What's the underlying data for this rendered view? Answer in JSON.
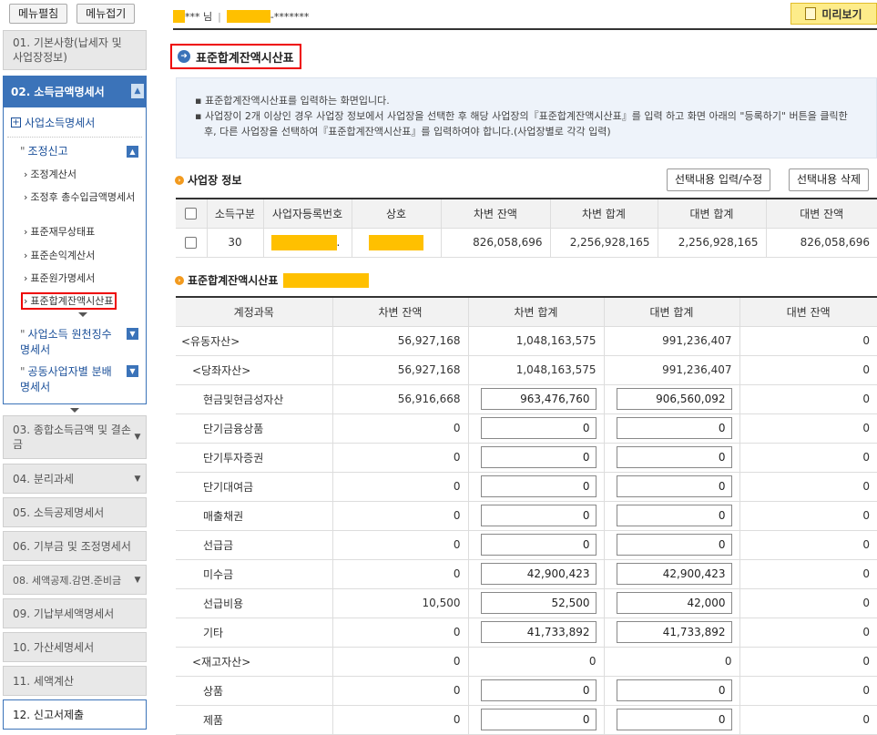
{
  "sidebar": {
    "expand_label": "메뉴펼침",
    "collapse_label": "메뉴접기",
    "menu01": "01. 기본사항(납세자 및 사업장정보)",
    "menu02": "02. 소득금액명세서",
    "sub_business": "사업소득명세서",
    "sub_adjust": "조정신고",
    "adjust_items": [
      "조정계산서",
      "조정후 총수입금액명세서",
      "표준재무상태표",
      "표준손익계산서",
      "표준원가명세서",
      "표준합계잔액시산표"
    ],
    "sub_withhold": "사업소득 원천징수명세서",
    "sub_joint": "공동사업자별 분배명세서",
    "menu03": "03. 종합소득금액 및 결손금",
    "menu04": "04. 분리과세",
    "menu05": "05. 소득공제명세서",
    "menu06": "06. 기부금 및 조정명세서",
    "menu08": "08. 세액공제.감면.준비금",
    "menu09": "09. 기납부세액명세서",
    "menu10": "10. 가산세명세서",
    "menu11": "11. 세액계산",
    "menu12": "12. 신고서제출"
  },
  "header": {
    "user_name_mask": "*** 님",
    "separator": "|",
    "user_id_mask": "-*******",
    "preview_label": "미리보기"
  },
  "page": {
    "title": "표준합계잔액시산표",
    "info_lines": [
      "표준합계잔액시산표를 입력하는 화면입니다.",
      "사업장이 2개 이상인 경우 사업장 정보에서 사업장을 선택한 후 해당 사업장의『표준합계잔액시산표』를 입력 하고 화면 아래의 \"등록하기\" 버튼을 클릭한 후, 다른 사업장을 선택하여『표준합계잔액시산표』를 입력하여야 합니다.(사업장별로 각각 입력)"
    ]
  },
  "business": {
    "section_title": "사업장 정보",
    "btn_edit": "선택내용 입력/수정",
    "btn_delete": "선택내용 삭제",
    "headers": [
      "소득구분",
      "사업자등록번호",
      "상호",
      "차변 잔액",
      "차변 합계",
      "대변 합계",
      "대변 잔액"
    ],
    "row": {
      "type": "30",
      "reg_suffix": ".",
      "debit_balance": "826,058,696",
      "debit_total": "2,256,928,165",
      "credit_total": "2,256,928,165",
      "credit_balance": "826,058,696"
    }
  },
  "trial": {
    "section_title": "표준합계잔액시산표",
    "headers": [
      "계정과목",
      "차변 잔액",
      "차변 합계",
      "대변 합계",
      "대변 잔액"
    ],
    "rows": [
      {
        "name": "<유동자산>",
        "indent": 0,
        "db": "56,927,168",
        "dt": "1,048,163,575",
        "ct": "991,236,407",
        "cb": "0",
        "input": false
      },
      {
        "name": "<당좌자산>",
        "indent": 1,
        "db": "56,927,168",
        "dt": "1,048,163,575",
        "ct": "991,236,407",
        "cb": "0",
        "input": false
      },
      {
        "name": "현금및현금성자산",
        "indent": 2,
        "db": "56,916,668",
        "dt": "963,476,760",
        "ct": "906,560,092",
        "cb": "0",
        "input": true
      },
      {
        "name": "단기금융상품",
        "indent": 2,
        "db": "0",
        "dt": "0",
        "ct": "0",
        "cb": "0",
        "input": true
      },
      {
        "name": "단기투자증권",
        "indent": 2,
        "db": "0",
        "dt": "0",
        "ct": "0",
        "cb": "0",
        "input": true
      },
      {
        "name": "단기대여금",
        "indent": 2,
        "db": "0",
        "dt": "0",
        "ct": "0",
        "cb": "0",
        "input": true
      },
      {
        "name": "매출채권",
        "indent": 2,
        "db": "0",
        "dt": "0",
        "ct": "0",
        "cb": "0",
        "input": true
      },
      {
        "name": "선급금",
        "indent": 2,
        "db": "0",
        "dt": "0",
        "ct": "0",
        "cb": "0",
        "input": true
      },
      {
        "name": "미수금",
        "indent": 2,
        "db": "0",
        "dt": "42,900,423",
        "ct": "42,900,423",
        "cb": "0",
        "input": true
      },
      {
        "name": "선급비용",
        "indent": 2,
        "db": "10,500",
        "dt": "52,500",
        "ct": "42,000",
        "cb": "0",
        "input": true
      },
      {
        "name": "기타",
        "indent": 2,
        "db": "0",
        "dt": "41,733,892",
        "ct": "41,733,892",
        "cb": "0",
        "input": true
      },
      {
        "name": "<재고자산>",
        "indent": 1,
        "db": "0",
        "dt": "0",
        "ct": "0",
        "cb": "0",
        "input": false
      },
      {
        "name": "상품",
        "indent": 2,
        "db": "0",
        "dt": "0",
        "ct": "0",
        "cb": "0",
        "input": true
      },
      {
        "name": "제품",
        "indent": 2,
        "db": "0",
        "dt": "0",
        "ct": "0",
        "cb": "0",
        "input": true
      }
    ]
  }
}
